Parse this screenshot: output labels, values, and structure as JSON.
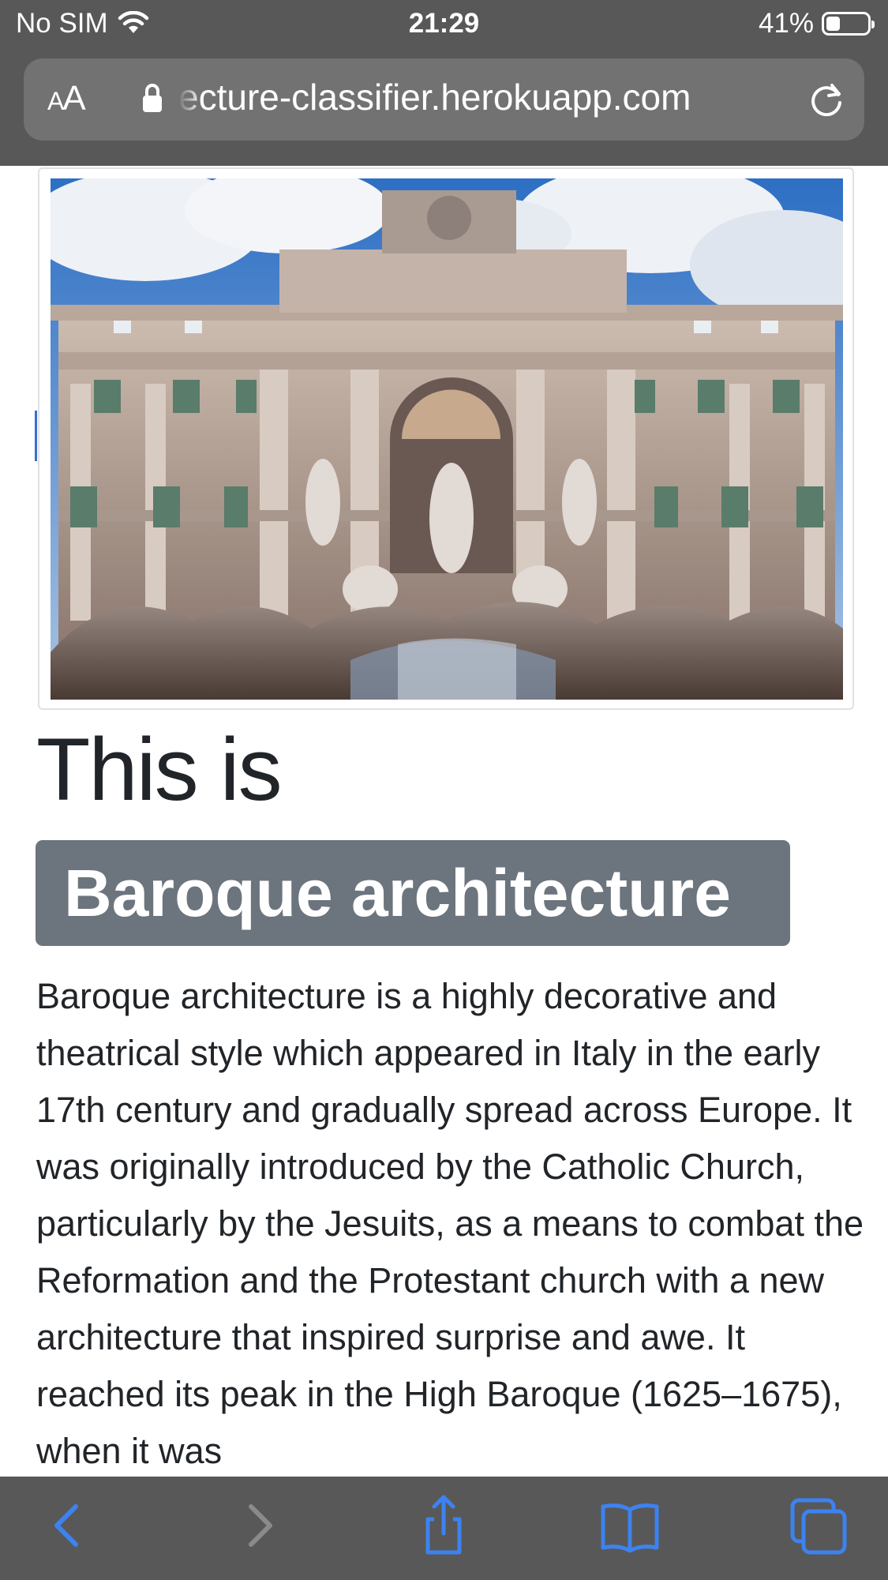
{
  "status_bar": {
    "carrier": "No SIM",
    "time": "21:29",
    "battery": "41%"
  },
  "browser": {
    "text_size_label": "AA",
    "url": "ecture-classifier.herokuapp.com"
  },
  "main": {
    "heading": "This is",
    "badge": "Baroque architecture",
    "description": "Baroque architecture is a highly decorative and theatrical style which appeared in Italy in the early 17th century and gradually spread across Europe. It was originally introduced by the Catholic Church, particularly by the Jesuits, as a means to combat the Reformation and the Protestant church with a new architecture that inspired surprise and awe. It reached its peak in the High Baroque (1625–1675), when it was"
  },
  "toolbar": {
    "icons": [
      "back-icon",
      "forward-icon",
      "share-icon",
      "bookmarks-icon",
      "tabs-icon"
    ]
  },
  "colors": {
    "chrome": "#585858",
    "url_field": "#727272",
    "badge": "#6c757d",
    "accent": "#3d82f0",
    "text": "#212529"
  }
}
